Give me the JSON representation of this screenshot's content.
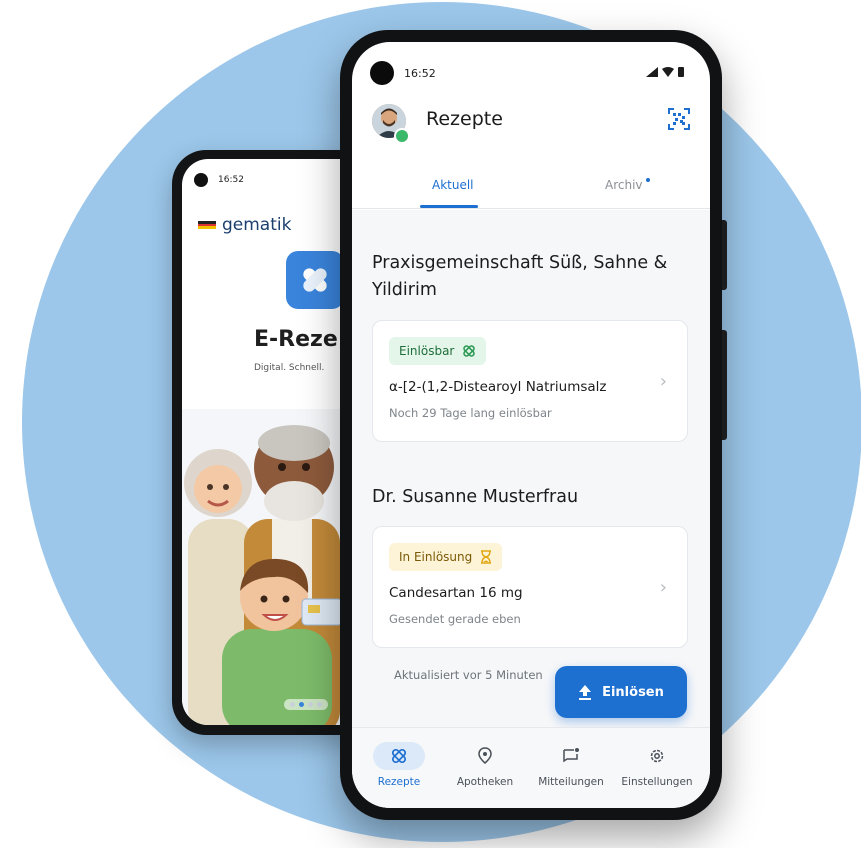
{
  "back_phone": {
    "time": "16:52",
    "brand": "gematik",
    "app_title": "E-Reze",
    "tagline": "Digital. Schnell.",
    "carousel_active": 1
  },
  "status_bar": {
    "time": "16:52"
  },
  "header": {
    "title": "Rezepte"
  },
  "tabs": [
    {
      "label": "Aktuell",
      "active": true
    },
    {
      "label": "Archiv",
      "active": false,
      "has_dot": true
    }
  ],
  "groups": [
    {
      "practice": "Praxisgemeinschaft Süß, Sahne & Yildirim",
      "prescription": {
        "badge": "Einlösbar",
        "badge_icon": "e-rezept-icon",
        "badge_color": "#e4f6ea",
        "medication": "α-[2-(1,2-Distearoyl Natriumsalz",
        "status": "Noch 29 Tage lang einlösbar"
      }
    },
    {
      "practice": "Dr. Susanne Musterfrau",
      "prescription": {
        "badge": "In Einlösung",
        "badge_icon": "hourglass-icon",
        "badge_color": "#fdf3d6",
        "medication": "Candesartan 16 mg",
        "status": "Gesendet gerade eben"
      }
    }
  ],
  "updated_text": "Aktualisiert vor 5 Minuten",
  "fab": {
    "label": "Einlösen",
    "icon": "upload-icon"
  },
  "bottom_nav": [
    {
      "label": "Rezepte",
      "icon": "e-rezept-icon",
      "active": true
    },
    {
      "label": "Apotheken",
      "icon": "location-pin-icon",
      "active": false
    },
    {
      "label": "Mitteilungen",
      "icon": "message-icon",
      "active": false
    },
    {
      "label": "Einstellungen",
      "icon": "gear-icon",
      "active": false
    }
  ],
  "colors": {
    "accent": "#1d6fd0",
    "background_circle": "#9cc7ea",
    "success_green": "#3bb86a"
  }
}
